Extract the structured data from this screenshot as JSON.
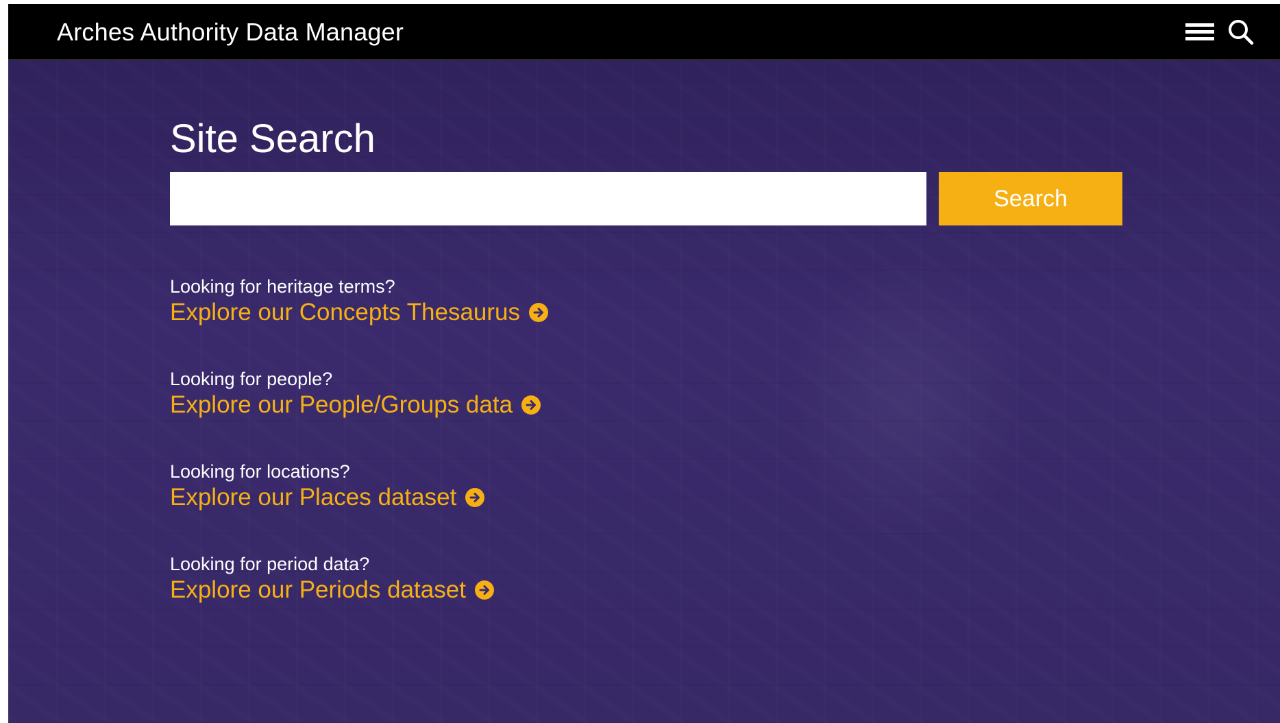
{
  "header": {
    "brand": "Arches Authority Data Manager",
    "menu_icon": "hamburger-menu-icon",
    "search_icon": "magnifier-search-icon"
  },
  "main": {
    "title": "Site Search",
    "search_input": {
      "value": "",
      "placeholder": ""
    },
    "search_button_label": "Search",
    "explore": [
      {
        "question": "Looking for heritage terms?",
        "link": "Explore our Concepts Thesaurus"
      },
      {
        "question": "Looking for people?",
        "link": "Explore our People/Groups data"
      },
      {
        "question": "Looking for locations?",
        "link": "Explore our Places dataset"
      },
      {
        "question": "Looking for period data?",
        "link": "Explore our Periods dataset"
      }
    ],
    "link_icon": "circle-arrow-right-icon"
  },
  "colors": {
    "topbar": "#000000",
    "background": "#3a2a6e",
    "accent": "#f7b014",
    "text": "#ffffff"
  }
}
